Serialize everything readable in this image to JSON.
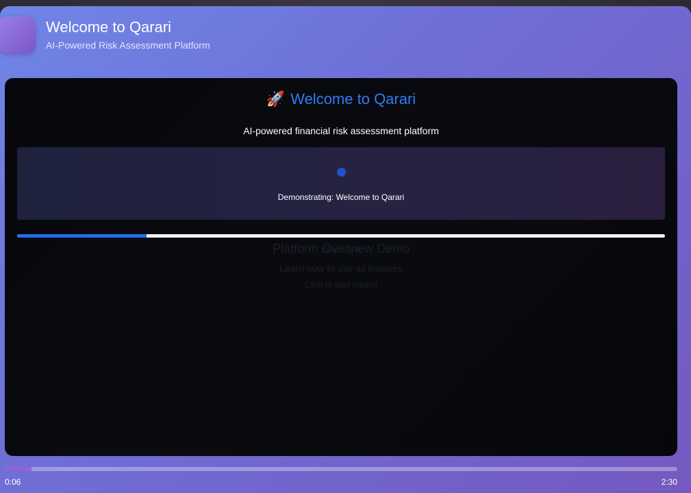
{
  "header": {
    "title": "Welcome to Qarari",
    "subtitle": "AI-Powered Risk Assessment Platform"
  },
  "video": {
    "background": {
      "title": "Platform Overview Demo",
      "step": "Step 1 of 8",
      "subtitle": "Learn how to use all features",
      "cta": "Click to start tutorial"
    },
    "overlay": {
      "icon": "rocket-icon",
      "icon_glyph": "🚀",
      "title": "Welcome to Qarari",
      "subtitle": "AI-powered financial risk assessment platform",
      "demo_text": "Demonstrating: Welcome to Qarari",
      "progress_fraction": 0.2
    }
  },
  "controls": {
    "current_time": "0:06",
    "duration": "2:30",
    "progress_fraction": 0.04
  },
  "colors": {
    "accent": "#1f6ff0",
    "title_blue": "#2f7cf0",
    "background_gradient_start": "#6f86e6",
    "background_gradient_end": "#7459c0"
  }
}
